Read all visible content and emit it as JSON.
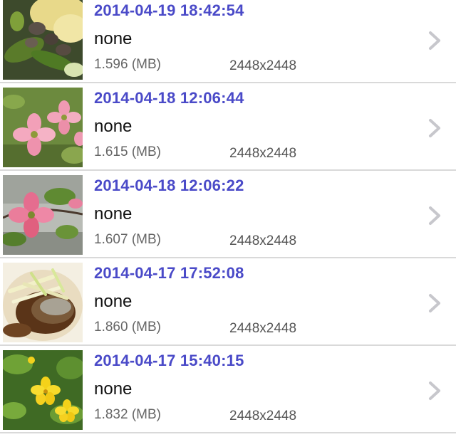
{
  "rows": [
    {
      "timestamp": "2014-04-19 18:42:54",
      "title": "none",
      "size": "1.596 (MB)",
      "dimensions": "2448x2448",
      "thumbnail": "mushroom-dish-photo"
    },
    {
      "timestamp": "2014-04-18 12:06:44",
      "title": "none",
      "size": "1.615 (MB)",
      "dimensions": "2448x2448",
      "thumbnail": "pink-dogwood-photo"
    },
    {
      "timestamp": "2014-04-18 12:06:22",
      "title": "none",
      "size": "1.607 (MB)",
      "dimensions": "2448x2448",
      "thumbnail": "pink-dogwood-closeup-photo"
    },
    {
      "timestamp": "2014-04-17 17:52:08",
      "title": "none",
      "size": "1.860 (MB)",
      "dimensions": "2448x2448",
      "thumbnail": "fish-dish-photo"
    },
    {
      "timestamp": "2014-04-17 15:40:15",
      "title": "none",
      "size": "1.832 (MB)",
      "dimensions": "2448x2448",
      "thumbnail": "yellow-kerria-photo"
    }
  ],
  "colors": {
    "timestamp": "#4a4ac8",
    "title": "#111111",
    "meta": "#666666",
    "chevron": "#c7c7cc",
    "separator": "#d9d9d9"
  },
  "icons": {
    "disclosure": "chevron-right-icon"
  }
}
